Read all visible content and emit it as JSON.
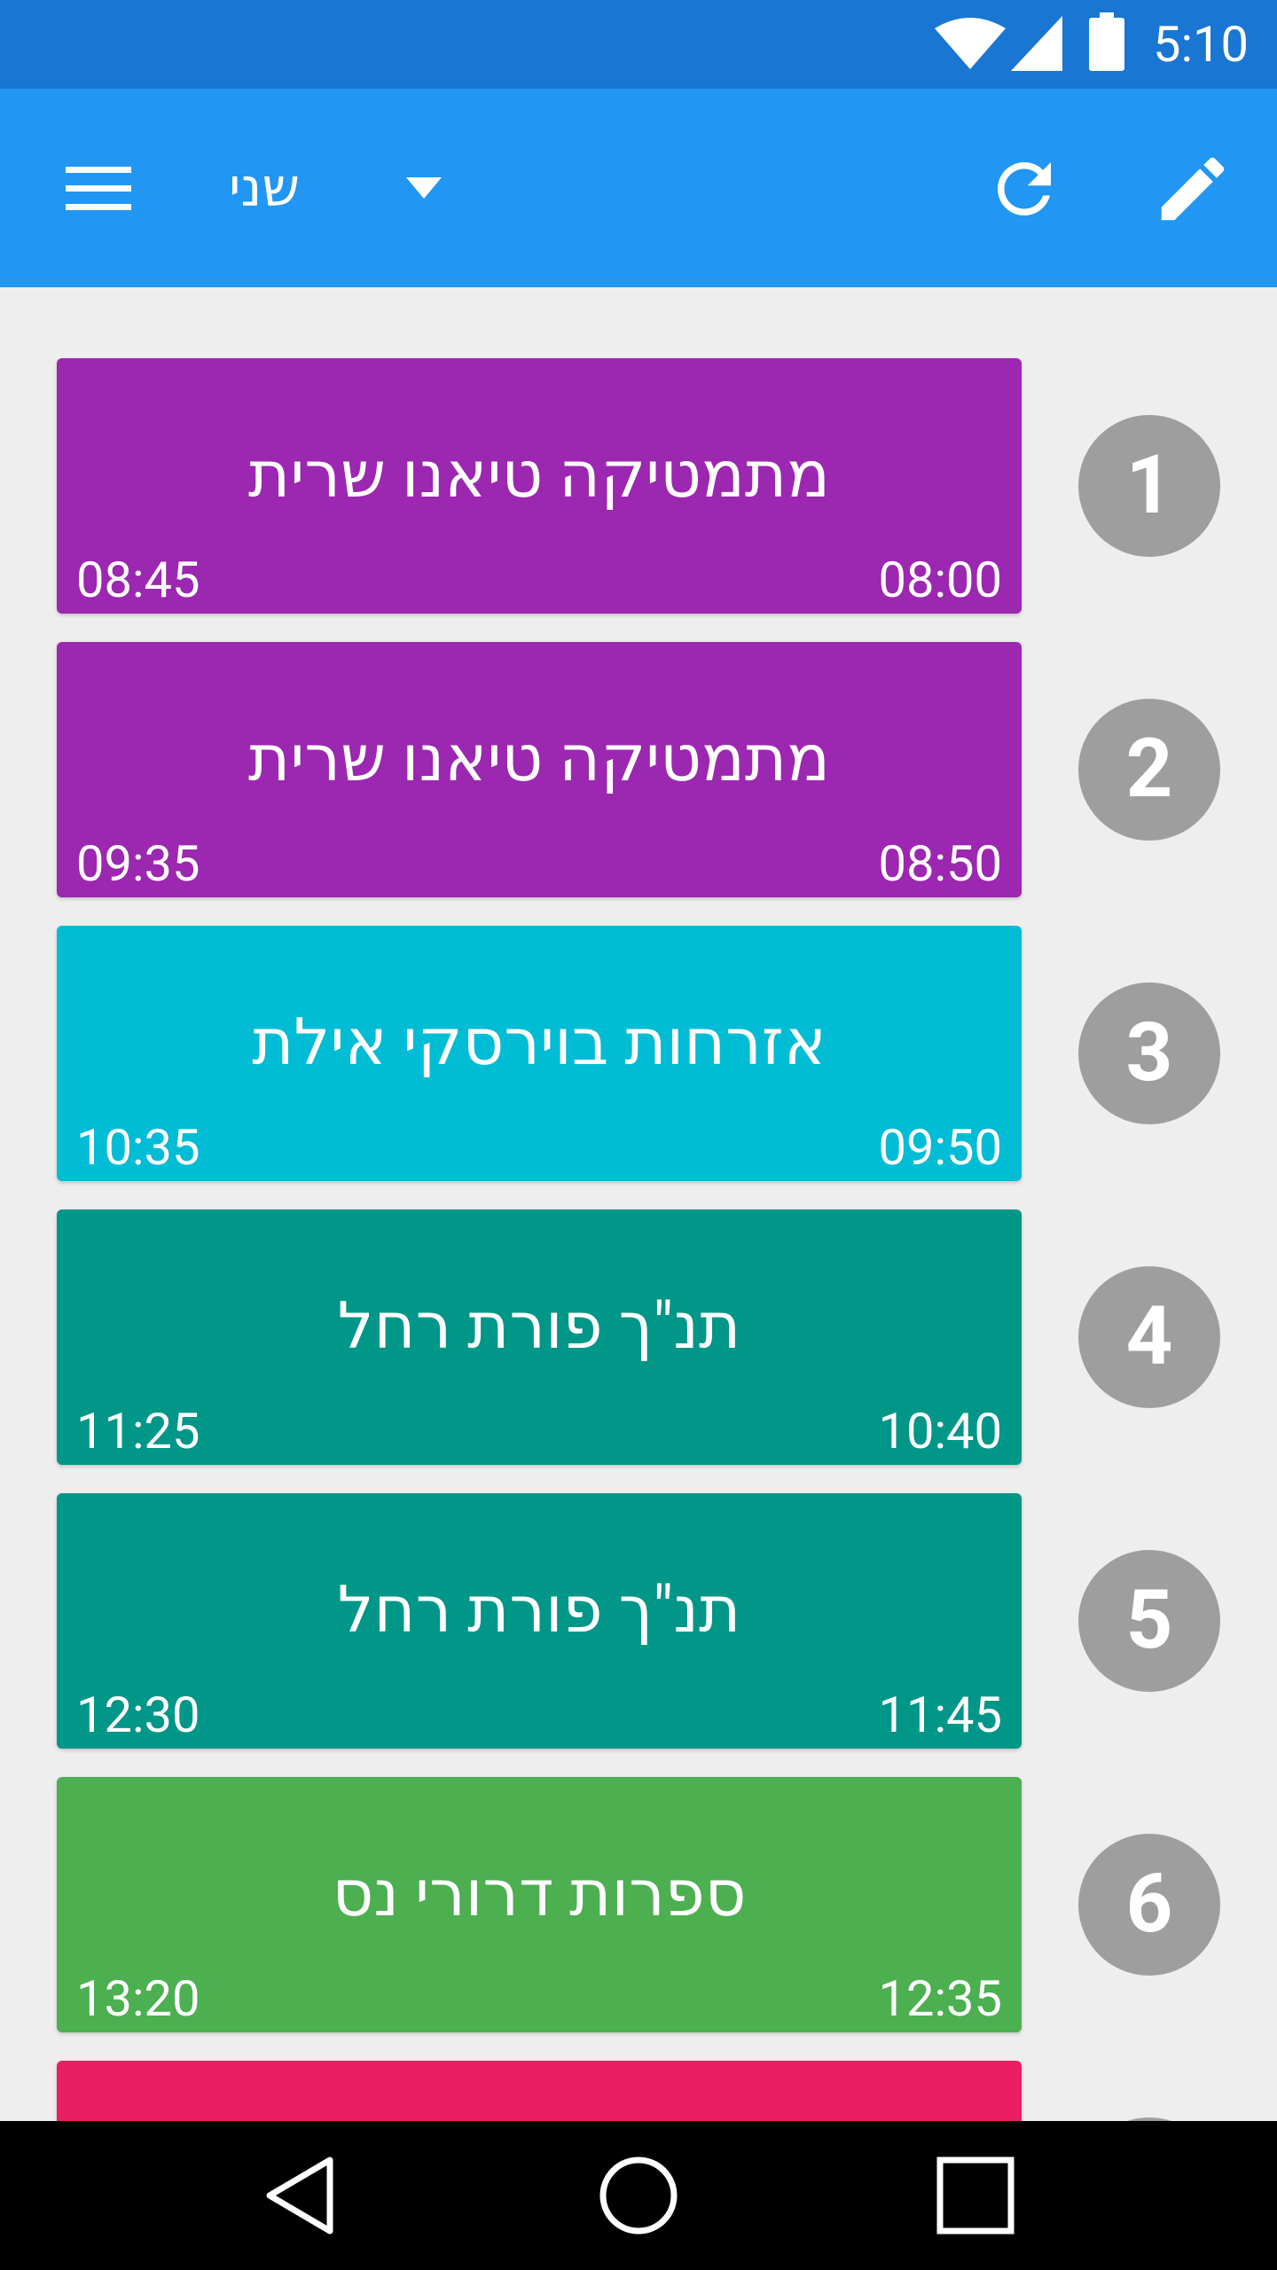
{
  "status_bar": {
    "time": "5:10",
    "icons": [
      "wifi-icon",
      "signal-icon",
      "battery-icon"
    ]
  },
  "app_bar": {
    "day": "שני",
    "icons": [
      "menu-icon",
      "dropdown-arrow-icon",
      "refresh-icon",
      "edit-icon"
    ]
  },
  "lessons": [
    {
      "number": "1",
      "subject": "מתמטיקה טיאנו שרית",
      "start": "08:00",
      "end": "08:45",
      "color": "#9c27b0"
    },
    {
      "number": "2",
      "subject": "מתמטיקה טיאנו שרית",
      "start": "08:50",
      "end": "09:35",
      "color": "#9c27b0"
    },
    {
      "number": "3",
      "subject": "אזרחות בוירסקי אילת",
      "start": "09:50",
      "end": "10:35",
      "color": "#00bcd4"
    },
    {
      "number": "4",
      "subject": "תנ\"ך פורת רחל",
      "start": "10:40",
      "end": "11:25",
      "color": "#009688"
    },
    {
      "number": "5",
      "subject": "תנ\"ך פורת רחל",
      "start": "11:45",
      "end": "12:30",
      "color": "#009688"
    },
    {
      "number": "6",
      "subject": "ספרות דרורי נס",
      "start": "12:35",
      "end": "13:20",
      "color": "#4caf50"
    },
    {
      "number": "",
      "subject": "",
      "start": "",
      "end": "",
      "color": "#e91e63"
    }
  ],
  "nav_bar": {
    "icons": [
      "back-icon",
      "home-icon",
      "recents-icon"
    ]
  },
  "colors": {
    "status_bar": "#1976d2",
    "app_bar": "#2196f3",
    "background": "#eeeeee",
    "number_circle": "#9e9e9e"
  }
}
